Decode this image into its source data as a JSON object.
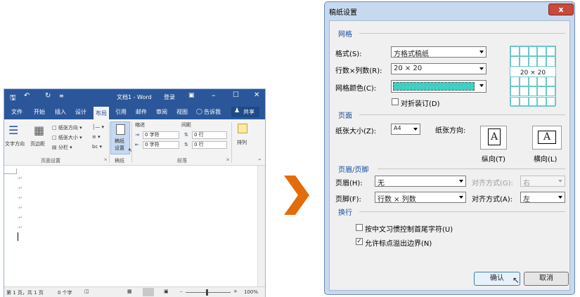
{
  "word": {
    "title": "文档1 - Word",
    "login": "登录",
    "tabs": [
      "文件",
      "开始",
      "插入",
      "设计",
      "布局",
      "引用",
      "邮件",
      "审阅",
      "视图"
    ],
    "tell_me": "告诉我",
    "share": "共享",
    "ribbon": {
      "text_direction": "文字方向",
      "margins": "页边距",
      "orientation": "纸张方向",
      "size": "纸张大小",
      "columns": "分栏",
      "page_setup_group": "页面设置",
      "manuscript_line1": "稿纸",
      "manuscript_line2": "设置",
      "manuscript_group": "稿纸",
      "indent_title": "缩进",
      "spacing_title": "间距",
      "indent_left": "0 字符",
      "indent_right": "0 字符",
      "space_before": "0 行",
      "space_after": "0 行",
      "paragraph_group": "段落",
      "arrange": "排列"
    },
    "status": {
      "page": "第 1 页，共 1 页",
      "words": "0 个字",
      "zoom": "100%"
    }
  },
  "dialog": {
    "title": "稿纸设置",
    "close": "x",
    "grid_section": "网格",
    "format_label": "格式(S):",
    "format_value": "方格式稿纸",
    "rows_cols_label": "行数×列数(R):",
    "rows_cols_value": "20 × 20",
    "grid_color_label": "网格颜色(C):",
    "grid_color": "#3dd1c4",
    "fold_binding": "对折装订(D)",
    "preview_text": "20 × 20",
    "page_section": "页面",
    "paper_size_label": "纸张大小(Z):",
    "paper_size_value": "A4",
    "orientation_label": "纸张方向:",
    "portrait": "纵向(T)",
    "landscape": "横向(L)",
    "header_footer_section": "页眉/页脚",
    "header_label": "页眉(H):",
    "header_value": "无",
    "header_align_label": "对齐方式(G):",
    "header_align_value": "右",
    "footer_label": "页脚(F):",
    "footer_value": "行数 × 列数",
    "footer_align_label": "对齐方式(A):",
    "footer_align_value": "左",
    "wrap_section": "换行",
    "opt1": "按中文习惯控制首尾字符(U)",
    "opt2": "允许标点溢出边界(N)",
    "opt1_checked": false,
    "opt2_checked": true,
    "ok": "确认",
    "cancel": "取消"
  }
}
